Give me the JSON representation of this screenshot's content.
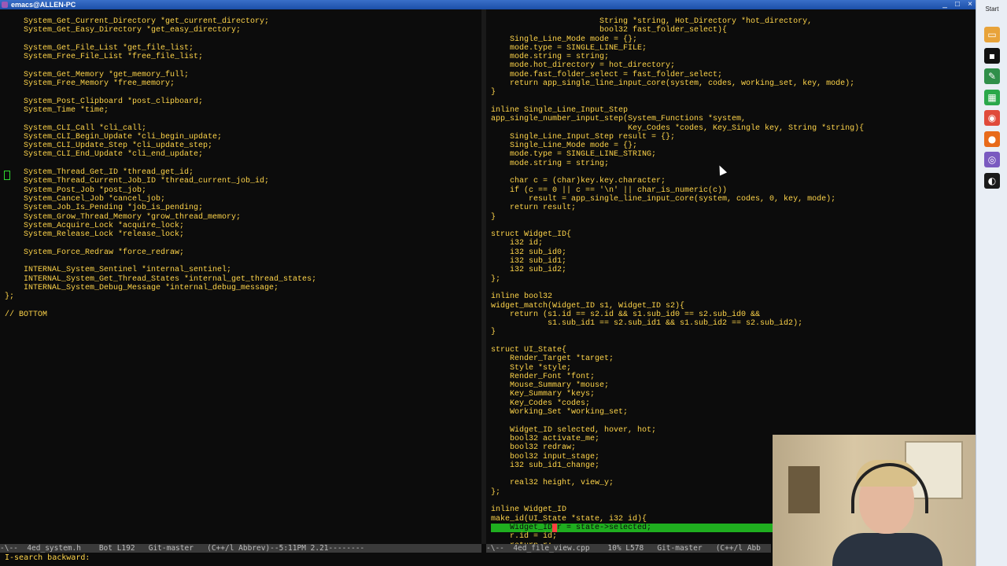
{
  "window": {
    "title": "emacs@ALLEN-PC",
    "controls": [
      "_",
      "□",
      "×"
    ]
  },
  "left_pane": {
    "lines": [
      "    System_Get_Current_Directory *get_current_directory;",
      "    System_Get_Easy_Directory *get_easy_directory;",
      "",
      "    System_Get_File_List *get_file_list;",
      "    System_Free_File_List *free_file_list;",
      "",
      "    System_Get_Memory *get_memory_full;",
      "    System_Free_Memory *free_memory;",
      "",
      "    System_Post_Clipboard *post_clipboard;",
      "    System_Time *time;",
      "",
      "    System_CLI_Call *cli_call;",
      "    System_CLI_Begin_Update *cli_begin_update;",
      "    System_CLI_Update_Step *cli_update_step;",
      "    System_CLI_End_Update *cli_end_update;",
      "",
      "    System_Thread_Get_ID *thread_get_id;",
      "    System_Thread_Current_Job_ID *thread_current_job_id;",
      "    System_Post_Job *post_job;",
      "    System_Cancel_Job *cancel_job;",
      "    System_Job_Is_Pending *job_is_pending;",
      "    System_Grow_Thread_Memory *grow_thread_memory;",
      "    System_Acquire_Lock *acquire_lock;",
      "    System_Release_Lock *release_lock;",
      "",
      "    System_Force_Redraw *force_redraw;",
      "",
      "    INTERNAL_System_Sentinel *internal_sentinel;",
      "    INTERNAL_System_Get_Thread_States *internal_get_thread_states;",
      "    INTERNAL_System_Debug_Message *internal_debug_message;",
      "};",
      "",
      "// BOTTOM"
    ]
  },
  "right_pane": {
    "lines": [
      "                       String *string, Hot_Directory *hot_directory,",
      "                       bool32 fast_folder_select){",
      "    Single_Line_Mode mode = {};",
      "    mode.type = SINGLE_LINE_FILE;",
      "    mode.string = string;",
      "    mode.hot_directory = hot_directory;",
      "    mode.fast_folder_select = fast_folder_select;",
      "    return app_single_line_input_core(system, codes, working_set, key, mode);",
      "}",
      "",
      "inline Single_Line_Input_Step",
      "app_single_number_input_step(System_Functions *system,",
      "                             Key_Codes *codes, Key_Single key, String *string){",
      "    Single_Line_Input_Step result = {};",
      "    Single_Line_Mode mode = {};",
      "    mode.type = SINGLE_LINE_STRING;",
      "    mode.string = string;",
      "",
      "    char c = (char)key.key.character;",
      "    if (c == 0 || c == '\\n' || char_is_numeric(c))",
      "        result = app_single_line_input_core(system, codes, 0, key, mode);",
      "    return result;",
      "}",
      "",
      "struct Widget_ID{",
      "    i32 id;",
      "    i32 sub_id0;",
      "    i32 sub_id1;",
      "    i32 sub_id2;",
      "};",
      "",
      "inline bool32",
      "widget_match(Widget_ID s1, Widget_ID s2){",
      "    return (s1.id == s2.id && s1.sub_id0 == s2.sub_id0 &&",
      "            s1.sub_id1 == s2.sub_id1 && s1.sub_id2 == s2.sub_id2);",
      "}",
      "",
      "struct UI_State{",
      "    Render_Target *target;",
      "    Style *style;",
      "    Render_Font *font;",
      "    Mouse_Summary *mouse;",
      "    Key_Summary *keys;",
      "    Key_Codes *codes;",
      "    Working_Set *working_set;",
      "",
      "    Widget_ID selected, hover, hot;",
      "    bool32 activate_me;",
      "    bool32 redraw;",
      "    bool32 input_stage;",
      "    i32 sub_id1_change;",
      "",
      "    real32 height, view_y;",
      "};",
      "",
      "inline Widget_ID",
      "make_id(UI_State *state, i32 id){",
      "    Widget_ID r = state->selected;",
      "    r.id = id;",
      "    return r;"
    ],
    "highlight_line": {
      "before": "    Widget_ID",
      "cursor": " ",
      "after": "r = state->selected;"
    }
  },
  "modeline_left": "-\\--  4ed_system.h    Bot L192   Git-master   (C++/l Abbrev)--5:11PM 2.21--------",
  "modeline_right": "-\\--  4ed_file_view.cpp    10% L578   Git-master   (C++/l Abb",
  "minibuffer": "I-search backward:",
  "taskbar": {
    "start_label": "Start",
    "icons": [
      {
        "name": "explorer-icon",
        "color": "#e8a33a",
        "glyph": "▭"
      },
      {
        "name": "terminal-icon",
        "color": "#111111",
        "glyph": "▪"
      },
      {
        "name": "emacs-icon",
        "color": "#2f8f4a",
        "glyph": "✎"
      },
      {
        "name": "spreadsheet-icon",
        "color": "#2aa84a",
        "glyph": "▦"
      },
      {
        "name": "chrome-icon",
        "color": "#e04a3a",
        "glyph": "◉"
      },
      {
        "name": "firefox-icon",
        "color": "#e86a1a",
        "glyph": "●"
      },
      {
        "name": "emacs-active-icon",
        "color": "#7a5ac0",
        "glyph": "◎"
      },
      {
        "name": "steam-icon",
        "color": "#1a1a1a",
        "glyph": "◐"
      }
    ]
  },
  "colors": {
    "code_text": "#ffd54a",
    "background": "#0c0c0c",
    "highlight": "#1fae1f",
    "cursor": "#ff4040",
    "modeline_bg": "#3a3a3a"
  }
}
